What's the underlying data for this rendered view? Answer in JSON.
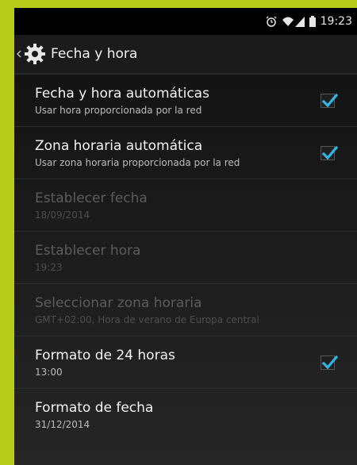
{
  "status_bar": {
    "time": "19:23",
    "icons": [
      "alarm-icon",
      "wifi-icon",
      "signal-icon",
      "battery-icon"
    ]
  },
  "action_bar": {
    "title": "Fecha y hora",
    "icon": "gear-icon"
  },
  "settings": [
    {
      "label": "Fecha y hora automáticas",
      "summary": "Usar hora proporcionada por la red",
      "enabled": true,
      "checkbox": true,
      "checked": true
    },
    {
      "label": "Zona horaria automática",
      "summary": "Usar zona horaria proporcionada por la red",
      "enabled": true,
      "checkbox": true,
      "checked": true
    },
    {
      "label": "Establecer fecha",
      "summary": "18/09/2014",
      "enabled": false,
      "checkbox": false
    },
    {
      "label": "Establecer hora",
      "summary": "19:23",
      "enabled": false,
      "checkbox": false
    },
    {
      "label": "Seleccionar zona horaria",
      "summary": "GMT+02:00, Hora de verano de Europa central",
      "enabled": false,
      "checkbox": false
    },
    {
      "label": "Formato de 24 horas",
      "summary": "13:00",
      "enabled": true,
      "checkbox": true,
      "checked": true
    },
    {
      "label": "Formato de fecha",
      "summary": "31/12/2014",
      "enabled": true,
      "checkbox": false
    }
  ],
  "colors": {
    "accent": "#33b5e5",
    "frame": "#b7cc1a",
    "background": "#0e0e0e"
  }
}
